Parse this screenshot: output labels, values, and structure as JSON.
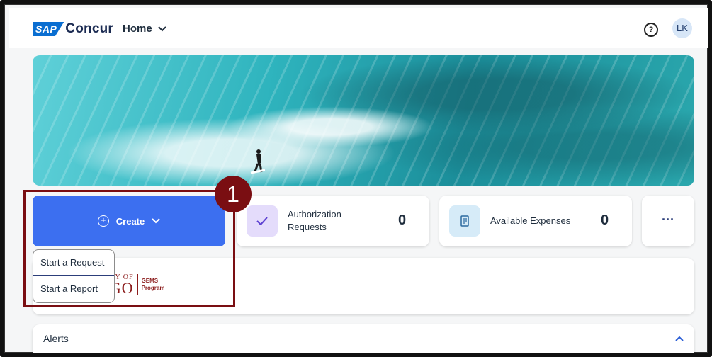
{
  "header": {
    "logo_sap": "SAP",
    "logo_concur": "Concur",
    "home_label": "Home",
    "home_icon": "chevron-down-icon",
    "help_icon": "question-circle-icon",
    "help_glyph": "?",
    "avatar_initials": "LK"
  },
  "tiles": {
    "create_label": "Create",
    "authorization": {
      "label_line1": "Authorization",
      "label_line2": "Requests",
      "count": "0",
      "icon": "check-icon"
    },
    "expenses": {
      "label": "Available Expenses",
      "count": "0",
      "icon": "receipt-icon"
    },
    "more_glyph": "···"
  },
  "create_menu": {
    "items": [
      "Start a Request",
      "Start a Report"
    ]
  },
  "callout": {
    "number": "1"
  },
  "university_banner": {
    "left_top": "ITY OF",
    "left_bottom": "GO",
    "right_top": "GEMS",
    "right_bottom": "Program"
  },
  "alerts": {
    "title": "Alerts",
    "toggle_icon": "chevron-up-icon"
  },
  "colors": {
    "create_blue": "#3c6ff0",
    "callout_red": "#7a0e12",
    "avatar_bg": "#d7e6f7"
  }
}
